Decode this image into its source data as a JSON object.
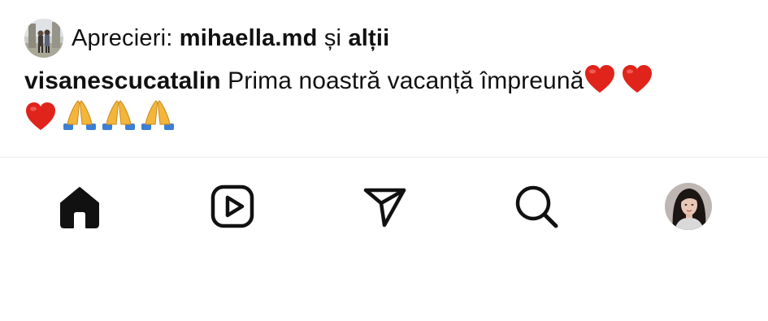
{
  "likes": {
    "prefix": "Aprecieri: ",
    "user": "mihaella.md",
    "conjunction": " și ",
    "others": "alții"
  },
  "caption": {
    "username": "visanescucatalin",
    "text": "Prima noastră vacanță împreună",
    "emojis": [
      "red-heart",
      "red-heart",
      "red-heart",
      "folded-hands",
      "folded-hands",
      "folded-hands"
    ]
  },
  "nav": {
    "items": [
      "home-icon",
      "reels-icon",
      "direct-messages-icon",
      "search-icon",
      "profile-avatar"
    ]
  },
  "colors": {
    "heart": "#e0241b",
    "hands": "#f4b63a",
    "sleeve": "#3b7fd6",
    "icon": "#111111",
    "divider": "#ececec"
  }
}
